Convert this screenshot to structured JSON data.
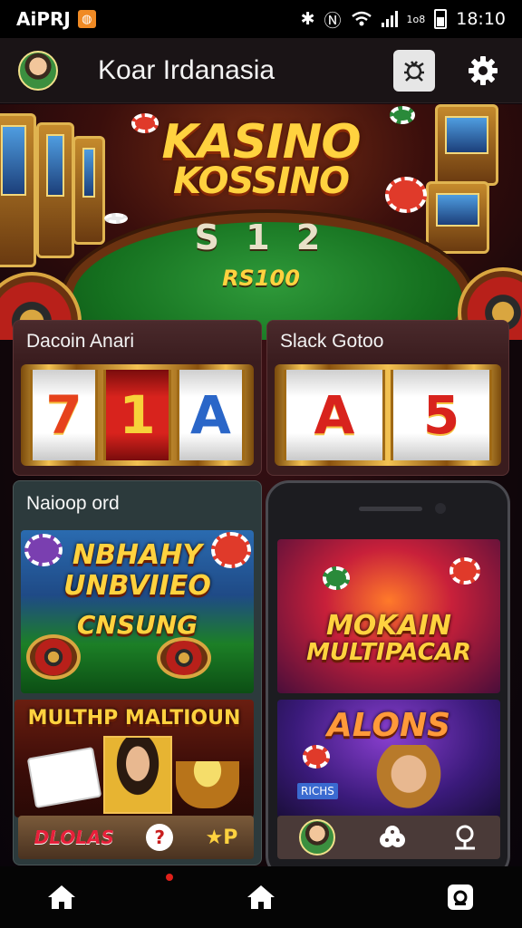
{
  "status_bar": {
    "carrier": "AiPRJ",
    "network_label": "1ᴏ8",
    "time": "18:10"
  },
  "app_bar": {
    "title": "Koar Irdanasia"
  },
  "hero": {
    "title_line1": "KASINO",
    "title_line2": "KOSSINO",
    "digits": "S 1 2",
    "amount": "RS100"
  },
  "slot_cards": [
    {
      "title": "Dacoin Anari",
      "reels": [
        "7",
        "1",
        "A"
      ]
    },
    {
      "title": "Slack Gotoo",
      "reels": [
        "A",
        "5"
      ]
    }
  ],
  "game_grid": {
    "title": "Naioop ord",
    "tiles": [
      {
        "title_line1": "NBHAHY",
        "title_line2": "UNBVIIEO",
        "subtitle": "CNSUNG"
      },
      {
        "title_line1": "MOKAIN",
        "title_line2": "MULTIPACAR"
      },
      {
        "title_line1": "MULTHP MALTIOUN"
      },
      {
        "title_line1": "ALONS"
      }
    ],
    "tray_left": [
      "DLOLAS",
      "?",
      "★P"
    ],
    "tray_right_badge": "RICHS"
  },
  "colors": {
    "accent_gold": "#ffd23f",
    "felt_green": "#1c7f26",
    "card_maroon": "#3a1c1e"
  },
  "icons": {
    "header": [
      "avatar",
      "bug-icon",
      "gear-icon"
    ],
    "nav": [
      "home-icon",
      "home-icon",
      "instagram-icon"
    ]
  }
}
